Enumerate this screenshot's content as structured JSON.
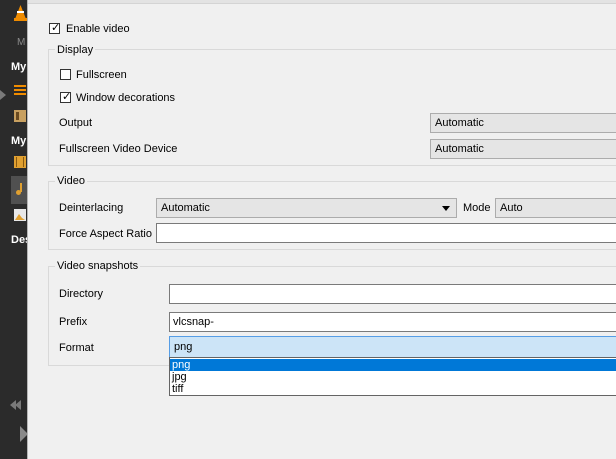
{
  "background": {
    "sidebar_labels": [
      "My",
      "My",
      "Des"
    ],
    "dim_label": "M"
  },
  "dialog": {
    "enable_video_label": "Enable video",
    "enable_video_checked": true,
    "display": {
      "title": "Display",
      "fullscreen_label": "Fullscreen",
      "fullscreen_checked": false,
      "window_decorations_label": "Window decorations",
      "window_decorations_checked": true,
      "output_label": "Output",
      "output_value": "Automatic",
      "fullscreen_device_label": "Fullscreen Video Device",
      "fullscreen_device_value": "Automatic"
    },
    "video": {
      "title": "Video",
      "deinterlacing_label": "Deinterlacing",
      "deinterlacing_value": "Automatic",
      "mode_label": "Mode",
      "mode_value": "Auto",
      "aspect_label": "Force Aspect Ratio",
      "aspect_value": ""
    },
    "snapshots": {
      "title": "Video snapshots",
      "directory_label": "Directory",
      "directory_value": "",
      "prefix_label": "Prefix",
      "prefix_value": "vlcsnap-",
      "format_label": "Format",
      "format_value": "png",
      "format_options": [
        "png",
        "jpg",
        "tiff"
      ],
      "format_selected_index": 0
    }
  },
  "colors": {
    "accent": "#0078d7",
    "combo_focus": "#cce4f7",
    "vlc_orange": "#f08c00"
  }
}
